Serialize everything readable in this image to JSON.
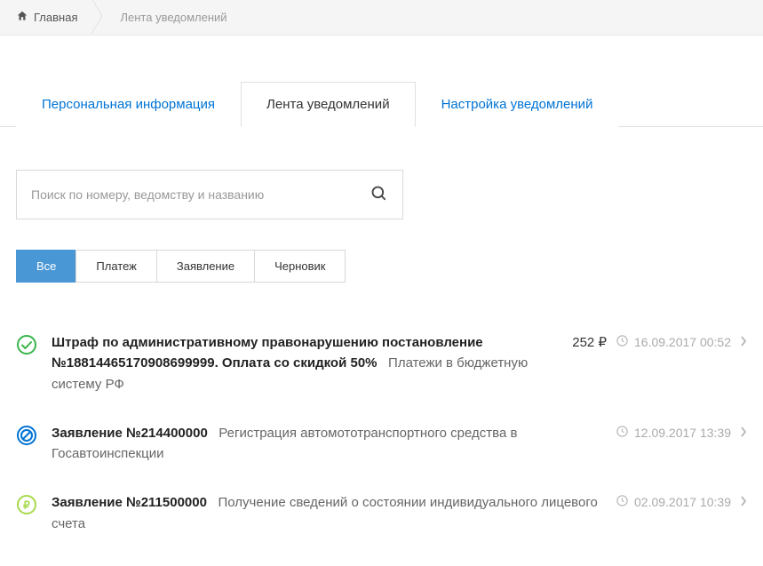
{
  "breadcrumb": {
    "home": "Главная",
    "current": "Лента уведомлений"
  },
  "tabs": [
    {
      "label": "Персональная информация",
      "active": false
    },
    {
      "label": "Лента уведомлений",
      "active": true
    },
    {
      "label": "Настройка уведомлений",
      "active": false
    }
  ],
  "search": {
    "placeholder": "Поиск по номеру, ведомству и названию"
  },
  "filters": [
    {
      "label": "Все",
      "active": true
    },
    {
      "label": "Платеж",
      "active": false
    },
    {
      "label": "Заявление",
      "active": false
    },
    {
      "label": "Черновик",
      "active": false
    }
  ],
  "items": [
    {
      "icon": "check-circle",
      "icon_color": "#3ab54a",
      "title": "Штраф по административному правонарушению постановление №18814465170908699999. Оплата со скидкой 50%",
      "desc": "Платежи в бюджетную систему РФ",
      "amount": "252",
      "currency": "₽",
      "date": "16.09.2017 00:52"
    },
    {
      "icon": "denied-circle",
      "icon_color": "#0073d4",
      "title": "Заявление №214400000",
      "desc": "Регистрация автомототранспортного средства в Госавтоинспекции",
      "amount": "",
      "currency": "",
      "date": "12.09.2017 13:39"
    },
    {
      "icon": "ruble-circle",
      "icon_color": "#a7d94c",
      "title": "Заявление №211500000",
      "desc": "Получение сведений о состоянии индивидуального лицевого счета",
      "amount": "",
      "currency": "",
      "date": "02.09.2017 10:39"
    }
  ]
}
